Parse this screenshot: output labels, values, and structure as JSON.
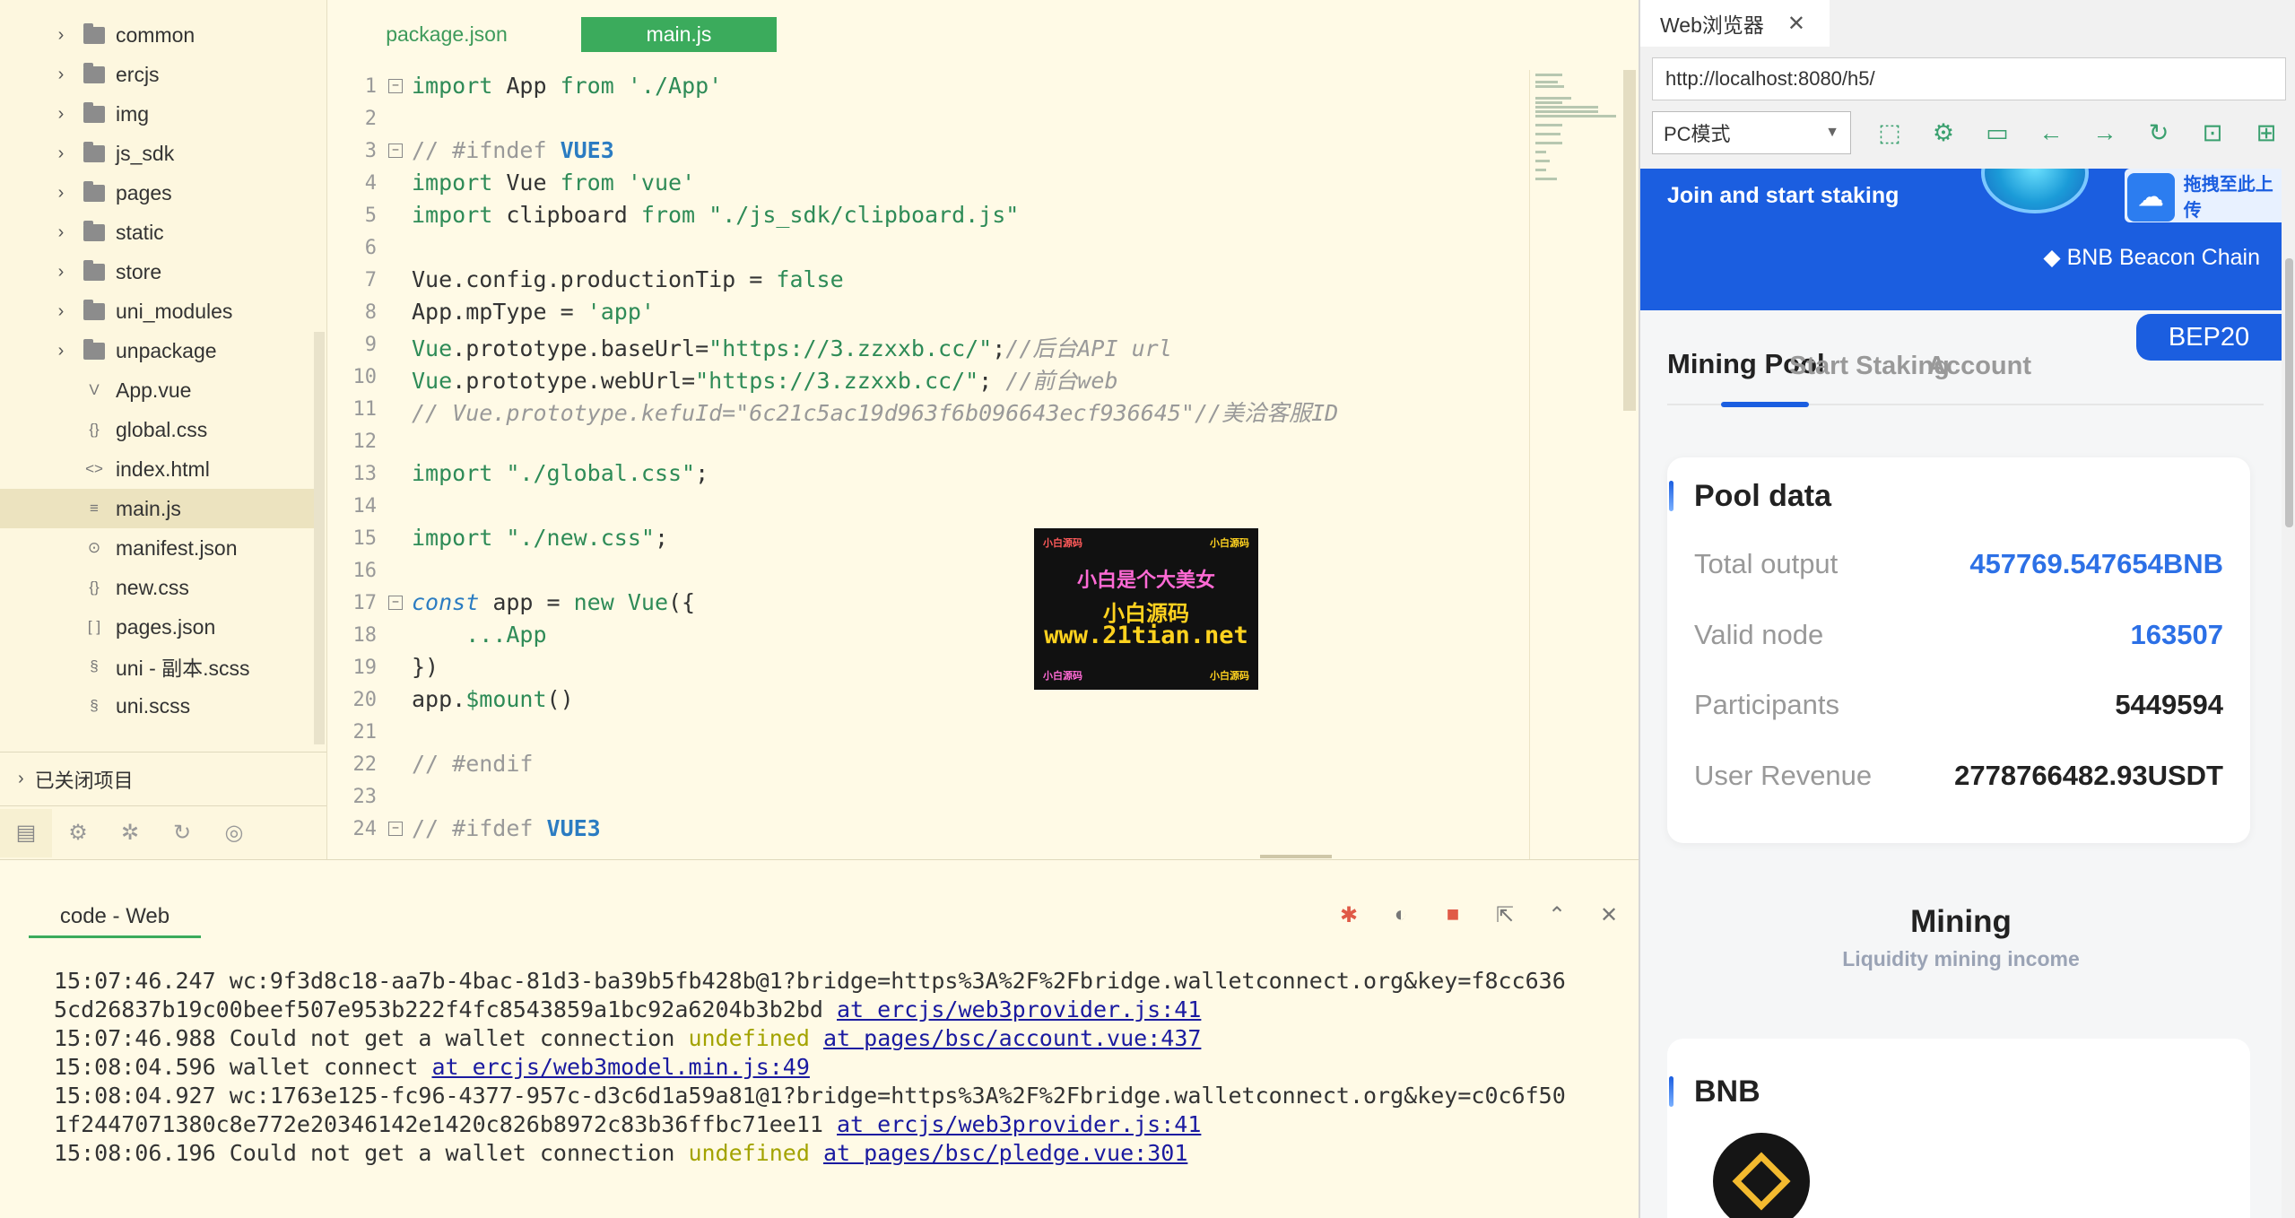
{
  "sidebar": {
    "items": [
      {
        "label": "common",
        "type": "folder"
      },
      {
        "label": "ercjs",
        "type": "folder"
      },
      {
        "label": "img",
        "type": "folder"
      },
      {
        "label": "js_sdk",
        "type": "folder"
      },
      {
        "label": "pages",
        "type": "folder"
      },
      {
        "label": "static",
        "type": "folder"
      },
      {
        "label": "store",
        "type": "folder"
      },
      {
        "label": "uni_modules",
        "type": "folder"
      },
      {
        "label": "unpackage",
        "type": "folder"
      },
      {
        "label": "App.vue",
        "type": "vue-file-icon"
      },
      {
        "label": "global.css",
        "type": "css-file-icon"
      },
      {
        "label": "index.html",
        "type": "html-file-icon"
      },
      {
        "label": "main.js",
        "type": "js-file-icon",
        "selected": true
      },
      {
        "label": "manifest.json",
        "type": "manifest-file-icon"
      },
      {
        "label": "new.css",
        "type": "css-file-icon"
      },
      {
        "label": "pages.json",
        "type": "json-file-icon"
      },
      {
        "label": "uni - 副本.scss",
        "type": "scss-file-icon"
      },
      {
        "label": "uni.scss",
        "type": "scss-file-icon"
      }
    ],
    "closed_projects": "已关闭项目"
  },
  "editor": {
    "tabs": [
      "package.json",
      "main.js"
    ],
    "active_tab": "main.js",
    "line_numbers": [
      "1",
      "2",
      "3",
      "4",
      "5",
      "6",
      "7",
      "8",
      "9",
      "10",
      "11",
      "12",
      "13",
      "14",
      "15",
      "16",
      "17",
      "18",
      "19",
      "20",
      "21",
      "22",
      "23",
      "24"
    ],
    "watermark": {
      "line1": "小白是个大美女",
      "line2": "小白源码",
      "line3": "www.21tian.net",
      "corner_tl": "小白源码",
      "corner_tr": "小白源码",
      "corner_bl": "小白源码",
      "corner_br": "小白源码"
    }
  },
  "console": {
    "tab": "code - Web",
    "lines": [
      {
        "time": "15:07:46.247",
        "text": "wc:9f3d8c18-aa7b-4bac-81d3-ba39b5fb428b@1?bridge=https%3A%2F%2Fbridge.walletconnect.org&key=f8cc636",
        "cont": "5cd26837b19c00beef507e953b222f4fc8543859a1bc92a6204b3b2bd",
        "link": "at ercjs/web3provider.js:41"
      },
      {
        "time": "15:07:46.988",
        "text": "Could not get a wallet connection",
        "undef": "undefined",
        "link": "at pages/bsc/account.vue:437"
      },
      {
        "time": "15:08:04.596",
        "text": "wallet connect",
        "link": "at ercjs/web3model.min.js:49"
      },
      {
        "time": "15:08:04.927",
        "text": "wc:1763e125-fc96-4377-957c-d3c6d1a59a81@1?bridge=https%3A%2F%2Fbridge.walletconnect.org&key=c0c6f50",
        "cont": "1f2447071380c8e772e20346142e1420c826b8972c83b36ffbc71ee11",
        "link": "at ercjs/web3provider.js:41"
      },
      {
        "time": "15:08:06.196",
        "text": "Could not get a wallet connection",
        "undef": "undefined",
        "link": "at pages/bsc/pledge.vue:301"
      }
    ]
  },
  "browser": {
    "tab_title": "Web浏览器",
    "url": "http://localhost:8080/h5/",
    "mode": "PC模式",
    "drag_hint": "拖拽至此上传",
    "dapp": {
      "join": "Join and start staking",
      "chain": "BNB Beacon Chain",
      "badge": "BEP20",
      "nav": [
        "Mining Pool",
        "Start Staking",
        "Account"
      ],
      "pool_title": "Pool data",
      "rows": [
        {
          "label": "Total output",
          "value": "457769.547654BNB"
        },
        {
          "label": "Valid node",
          "value": "163507"
        },
        {
          "label": "Participants",
          "value": "5449594"
        },
        {
          "label": "User Revenue",
          "value": "2778766482.93USDT"
        }
      ],
      "mining_title": "Mining",
      "mining_sub": "Liquidity mining income",
      "bnb_title": "BNB"
    }
  },
  "colors": {
    "accent_green": "#3bab5c",
    "dapp_blue": "#1b5ee0",
    "editor_bg": "#fffae6"
  }
}
